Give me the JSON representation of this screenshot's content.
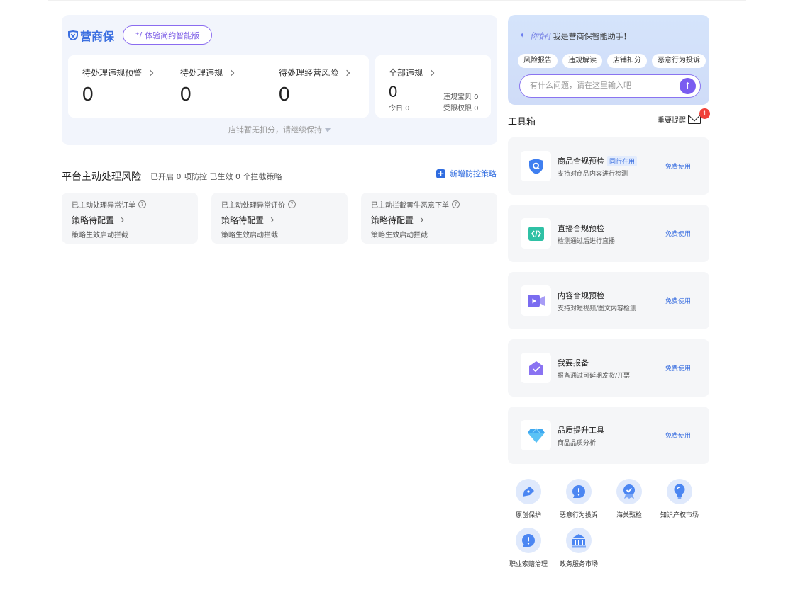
{
  "summary": {
    "brand": "营商保",
    "trial_button": "体验简约智能版",
    "stats": [
      {
        "label": "待处理违规预警",
        "value": "0"
      },
      {
        "label": "待处理违规",
        "value": "0"
      },
      {
        "label": "待处理经营风险",
        "value": "0"
      }
    ],
    "all_violations": {
      "label": "全部违规",
      "value": "0",
      "today": "今日 0",
      "violation_items": "违规宝贝 0",
      "restricted": "受限权限 0"
    },
    "footer": "店铺暂无扣分，请继续保持"
  },
  "risk": {
    "title": "平台主动处理风险",
    "subtitle": "已开启 0 项防控 已生效 0 个拦截策略",
    "add_button": "新增防控策略",
    "cards": [
      {
        "title": "已主动处理异常订单",
        "status": "策略待配置",
        "desc": "策略生效启动拦截"
      },
      {
        "title": "已主动处理异常评价",
        "status": "策略待配置",
        "desc": "策略生效启动拦截"
      },
      {
        "title": "已主动拦截黄牛恶意下单",
        "status": "策略待配置",
        "desc": "策略生效启动拦截"
      }
    ]
  },
  "assistant": {
    "hello": "你好!",
    "greeting": "我是营商保智能助手！",
    "chips": [
      "风险报告",
      "违规解读",
      "店铺扣分",
      "恶意行为投诉"
    ],
    "input_placeholder": "有什么问题，请在这里输入吧"
  },
  "toolbox": {
    "title": "工具箱",
    "notice_label": "重要提醒",
    "notice_count": "1",
    "tools": [
      {
        "name": "商品合规预检",
        "tag": "同行在用",
        "desc": "支持对商品内容进行检测",
        "action": "免费使用",
        "icon": "shield-search-icon"
      },
      {
        "name": "直播合规预检",
        "tag": "",
        "desc": "检测通过后进行直播",
        "action": "免费使用",
        "icon": "code-screen-icon"
      },
      {
        "name": "内容合规预检",
        "tag": "",
        "desc": "支持对短视频/图文内容检测",
        "action": "免费使用",
        "icon": "video-camera-icon"
      },
      {
        "name": "我要报备",
        "tag": "",
        "desc": "报备通过可延期发货/开票",
        "action": "免费使用",
        "icon": "envelope-check-icon"
      },
      {
        "name": "品质提升工具",
        "tag": "",
        "desc": "商品品质分析",
        "action": "免费使用",
        "icon": "diamond-icon"
      }
    ]
  },
  "services": [
    {
      "label": "原创保护",
      "icon": "pen-protect-icon"
    },
    {
      "label": "恶意行为投诉",
      "icon": "alert-bubble-icon"
    },
    {
      "label": "海关甄检",
      "icon": "badge-check-icon"
    },
    {
      "label": "知识产权市场",
      "icon": "lightbulb-icon"
    },
    {
      "label": "职业索赔治理",
      "icon": "alert-bubble-icon"
    },
    {
      "label": "政务服务市场",
      "icon": "government-building-icon"
    }
  ]
}
